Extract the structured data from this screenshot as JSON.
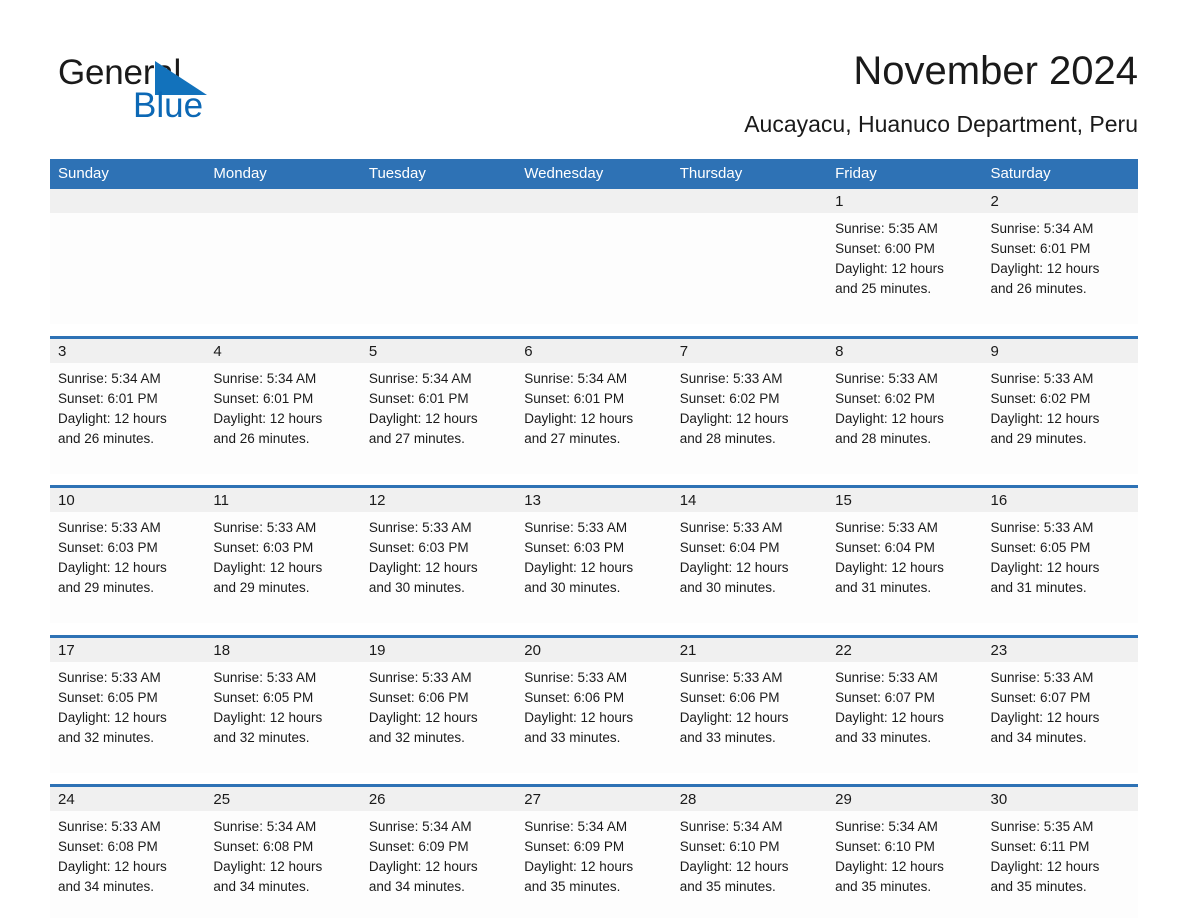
{
  "logo": {
    "word1": "General",
    "word2": "Blue",
    "triangle_color": "#1272bc",
    "word2_color": "#0c68b5"
  },
  "header": {
    "title": "November 2024",
    "subtitle": "Aucayacu, Huanuco Department, Peru"
  },
  "theme": {
    "header_blue": "#2e72b5",
    "row_rule_blue": "#2e72b5",
    "daynum_band": "#f0f0f0",
    "cell_bg": "#fdfdfd",
    "text": "#1a1a1a"
  },
  "calendar": {
    "weekday_headers": [
      "Sunday",
      "Monday",
      "Tuesday",
      "Wednesday",
      "Thursday",
      "Friday",
      "Saturday"
    ],
    "weeks": [
      [
        {
          "day": "",
          "empty": true
        },
        {
          "day": "",
          "empty": true
        },
        {
          "day": "",
          "empty": true
        },
        {
          "day": "",
          "empty": true
        },
        {
          "day": "",
          "empty": true
        },
        {
          "day": "1",
          "sunrise": "Sunrise: 5:35 AM",
          "sunset": "Sunset: 6:00 PM",
          "daylight1": "Daylight: 12 hours",
          "daylight2": "and 25 minutes."
        },
        {
          "day": "2",
          "sunrise": "Sunrise: 5:34 AM",
          "sunset": "Sunset: 6:01 PM",
          "daylight1": "Daylight: 12 hours",
          "daylight2": "and 26 minutes."
        }
      ],
      [
        {
          "day": "3",
          "sunrise": "Sunrise: 5:34 AM",
          "sunset": "Sunset: 6:01 PM",
          "daylight1": "Daylight: 12 hours",
          "daylight2": "and 26 minutes."
        },
        {
          "day": "4",
          "sunrise": "Sunrise: 5:34 AM",
          "sunset": "Sunset: 6:01 PM",
          "daylight1": "Daylight: 12 hours",
          "daylight2": "and 26 minutes."
        },
        {
          "day": "5",
          "sunrise": "Sunrise: 5:34 AM",
          "sunset": "Sunset: 6:01 PM",
          "daylight1": "Daylight: 12 hours",
          "daylight2": "and 27 minutes."
        },
        {
          "day": "6",
          "sunrise": "Sunrise: 5:34 AM",
          "sunset": "Sunset: 6:01 PM",
          "daylight1": "Daylight: 12 hours",
          "daylight2": "and 27 minutes."
        },
        {
          "day": "7",
          "sunrise": "Sunrise: 5:33 AM",
          "sunset": "Sunset: 6:02 PM",
          "daylight1": "Daylight: 12 hours",
          "daylight2": "and 28 minutes."
        },
        {
          "day": "8",
          "sunrise": "Sunrise: 5:33 AM",
          "sunset": "Sunset: 6:02 PM",
          "daylight1": "Daylight: 12 hours",
          "daylight2": "and 28 minutes."
        },
        {
          "day": "9",
          "sunrise": "Sunrise: 5:33 AM",
          "sunset": "Sunset: 6:02 PM",
          "daylight1": "Daylight: 12 hours",
          "daylight2": "and 29 minutes."
        }
      ],
      [
        {
          "day": "10",
          "sunrise": "Sunrise: 5:33 AM",
          "sunset": "Sunset: 6:03 PM",
          "daylight1": "Daylight: 12 hours",
          "daylight2": "and 29 minutes."
        },
        {
          "day": "11",
          "sunrise": "Sunrise: 5:33 AM",
          "sunset": "Sunset: 6:03 PM",
          "daylight1": "Daylight: 12 hours",
          "daylight2": "and 29 minutes."
        },
        {
          "day": "12",
          "sunrise": "Sunrise: 5:33 AM",
          "sunset": "Sunset: 6:03 PM",
          "daylight1": "Daylight: 12 hours",
          "daylight2": "and 30 minutes."
        },
        {
          "day": "13",
          "sunrise": "Sunrise: 5:33 AM",
          "sunset": "Sunset: 6:03 PM",
          "daylight1": "Daylight: 12 hours",
          "daylight2": "and 30 minutes."
        },
        {
          "day": "14",
          "sunrise": "Sunrise: 5:33 AM",
          "sunset": "Sunset: 6:04 PM",
          "daylight1": "Daylight: 12 hours",
          "daylight2": "and 30 minutes."
        },
        {
          "day": "15",
          "sunrise": "Sunrise: 5:33 AM",
          "sunset": "Sunset: 6:04 PM",
          "daylight1": "Daylight: 12 hours",
          "daylight2": "and 31 minutes."
        },
        {
          "day": "16",
          "sunrise": "Sunrise: 5:33 AM",
          "sunset": "Sunset: 6:05 PM",
          "daylight1": "Daylight: 12 hours",
          "daylight2": "and 31 minutes."
        }
      ],
      [
        {
          "day": "17",
          "sunrise": "Sunrise: 5:33 AM",
          "sunset": "Sunset: 6:05 PM",
          "daylight1": "Daylight: 12 hours",
          "daylight2": "and 32 minutes."
        },
        {
          "day": "18",
          "sunrise": "Sunrise: 5:33 AM",
          "sunset": "Sunset: 6:05 PM",
          "daylight1": "Daylight: 12 hours",
          "daylight2": "and 32 minutes."
        },
        {
          "day": "19",
          "sunrise": "Sunrise: 5:33 AM",
          "sunset": "Sunset: 6:06 PM",
          "daylight1": "Daylight: 12 hours",
          "daylight2": "and 32 minutes."
        },
        {
          "day": "20",
          "sunrise": "Sunrise: 5:33 AM",
          "sunset": "Sunset: 6:06 PM",
          "daylight1": "Daylight: 12 hours",
          "daylight2": "and 33 minutes."
        },
        {
          "day": "21",
          "sunrise": "Sunrise: 5:33 AM",
          "sunset": "Sunset: 6:06 PM",
          "daylight1": "Daylight: 12 hours",
          "daylight2": "and 33 minutes."
        },
        {
          "day": "22",
          "sunrise": "Sunrise: 5:33 AM",
          "sunset": "Sunset: 6:07 PM",
          "daylight1": "Daylight: 12 hours",
          "daylight2": "and 33 minutes."
        },
        {
          "day": "23",
          "sunrise": "Sunrise: 5:33 AM",
          "sunset": "Sunset: 6:07 PM",
          "daylight1": "Daylight: 12 hours",
          "daylight2": "and 34 minutes."
        }
      ],
      [
        {
          "day": "24",
          "sunrise": "Sunrise: 5:33 AM",
          "sunset": "Sunset: 6:08 PM",
          "daylight1": "Daylight: 12 hours",
          "daylight2": "and 34 minutes."
        },
        {
          "day": "25",
          "sunrise": "Sunrise: 5:34 AM",
          "sunset": "Sunset: 6:08 PM",
          "daylight1": "Daylight: 12 hours",
          "daylight2": "and 34 minutes."
        },
        {
          "day": "26",
          "sunrise": "Sunrise: 5:34 AM",
          "sunset": "Sunset: 6:09 PM",
          "daylight1": "Daylight: 12 hours",
          "daylight2": "and 34 minutes."
        },
        {
          "day": "27",
          "sunrise": "Sunrise: 5:34 AM",
          "sunset": "Sunset: 6:09 PM",
          "daylight1": "Daylight: 12 hours",
          "daylight2": "and 35 minutes."
        },
        {
          "day": "28",
          "sunrise": "Sunrise: 5:34 AM",
          "sunset": "Sunset: 6:10 PM",
          "daylight1": "Daylight: 12 hours",
          "daylight2": "and 35 minutes."
        },
        {
          "day": "29",
          "sunrise": "Sunrise: 5:34 AM",
          "sunset": "Sunset: 6:10 PM",
          "daylight1": "Daylight: 12 hours",
          "daylight2": "and 35 minutes."
        },
        {
          "day": "30",
          "sunrise": "Sunrise: 5:35 AM",
          "sunset": "Sunset: 6:11 PM",
          "daylight1": "Daylight: 12 hours",
          "daylight2": "and 35 minutes."
        }
      ]
    ]
  }
}
